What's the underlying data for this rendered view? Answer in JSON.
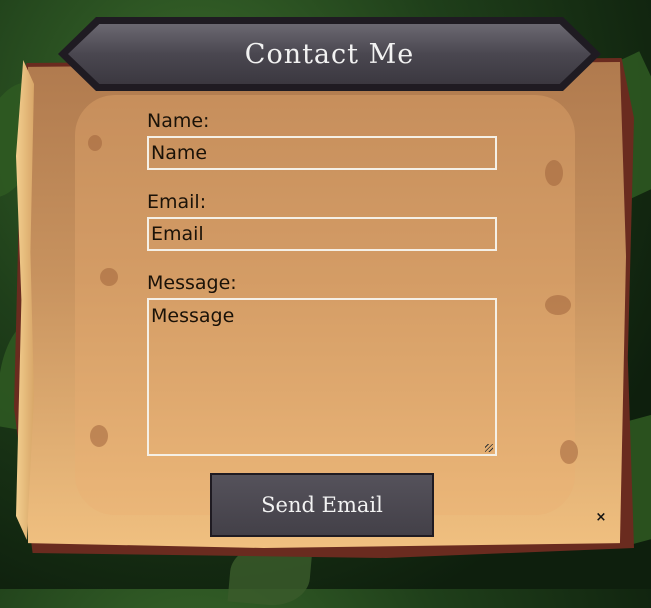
{
  "title": "Contact Me",
  "form": {
    "name_label": "Name:",
    "name_placeholder": "Name",
    "email_label": "Email:",
    "email_placeholder": "Email",
    "message_label": "Message:",
    "message_placeholder": "Message",
    "send_label": "Send Email"
  },
  "close_label": "×",
  "colors": {
    "parchment": "#c8935f",
    "plate": "#4a4750",
    "frame": "#6a2b1f"
  }
}
